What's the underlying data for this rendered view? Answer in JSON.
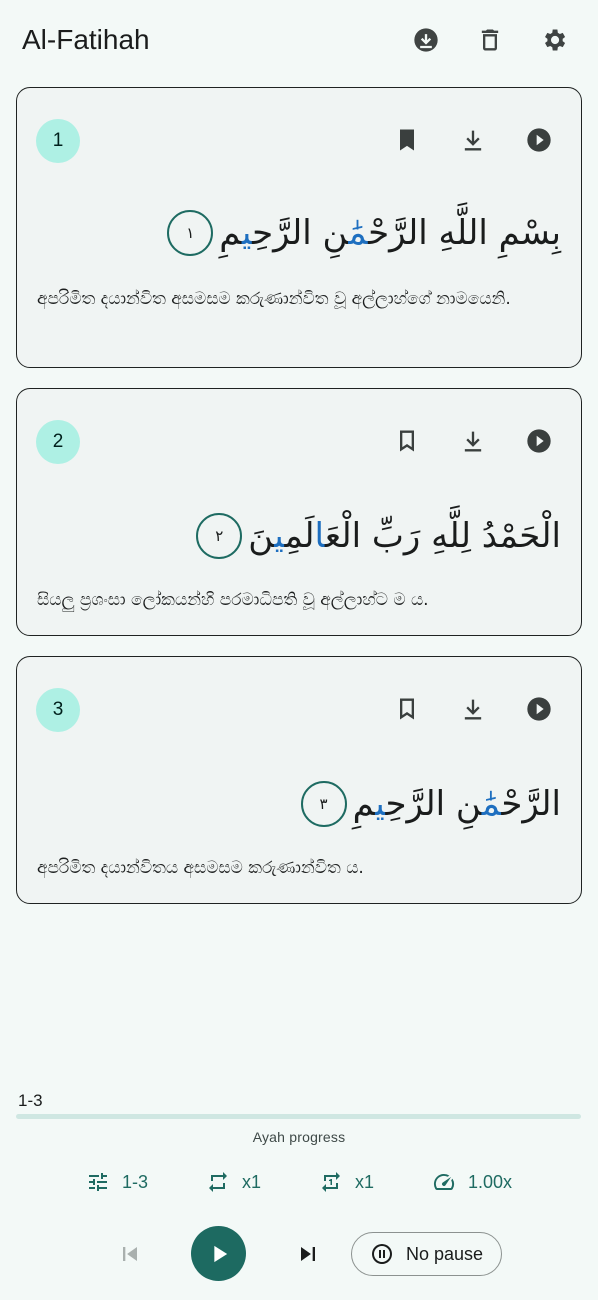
{
  "app": {
    "title": "Al-Fatihah",
    "actions": [
      "download-circle-icon",
      "delete-icon",
      "settings-icon"
    ]
  },
  "ayahs": [
    {
      "number": "1",
      "bookmarked": true,
      "arabic_before": "بِسْمِ اللَّهِ الرَّحْ",
      "arabic_hl": "مَٰ",
      "arabic_mid": "نِ الرَّحِ",
      "arabic_hl2": "ي",
      "arabic_after": "مِ",
      "marker": "١",
      "translation": "අපරිමිත දයාන්විත අසමසම කරුණාන්විත වූ අල්ලාහ්ගේ නාමයෙනි."
    },
    {
      "number": "2",
      "bookmarked": false,
      "arabic_before": "الْحَمْدُ لِلَّهِ رَبِّ الْعَ",
      "arabic_hl": "ا",
      "arabic_mid": "لَمِ",
      "arabic_hl2": "ي",
      "arabic_after": "نَ",
      "marker": "٢",
      "translation": "සියලු ප්‍රශංසා ලෝකයන්හි පරමාධිපති වූ අල්ලාහ්ට ම ය."
    },
    {
      "number": "3",
      "bookmarked": false,
      "arabic_before": "الرَّحْ",
      "arabic_hl": "مَٰ",
      "arabic_mid": "نِ الرَّحِ",
      "arabic_hl2": "ي",
      "arabic_after": "مِ",
      "marker": "٣",
      "translation": "අපරිමිත දයාන්විතය අසමසම කරුණාන්විත ය."
    }
  ],
  "player": {
    "range": "1-3",
    "progress_fraction": 0,
    "progress_caption": "Ayah progress",
    "chips": {
      "range": "1-3",
      "repeat_ayah": "x1",
      "repeat_range": "x1",
      "speed": "1.00x"
    },
    "pause_label": "No pause"
  },
  "colors": {
    "accent": "#1d6a61",
    "badge_bg": "#aef0e4",
    "highlight": "#1e6fc0",
    "background": "#f3f9f7"
  }
}
